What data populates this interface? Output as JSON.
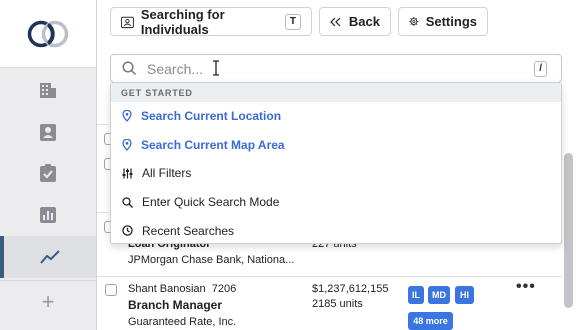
{
  "toolbar": {
    "search_mode_label": "Searching for Individuals",
    "search_mode_key": "T",
    "back_label": "Back",
    "settings_label": "Settings"
  },
  "search": {
    "placeholder": "Search...",
    "shortcut_key": "/"
  },
  "dropdown": {
    "header": "GET STARTED",
    "items": [
      {
        "label": "Search Current Location",
        "icon": "location-pin-icon"
      },
      {
        "label": "Search Current Map Area",
        "icon": "location-pin-icon"
      },
      {
        "label": "All Filters",
        "icon": "filters-icon"
      },
      {
        "label": "Enter Quick Search Mode",
        "icon": "search-icon"
      },
      {
        "label": "Recent Searches",
        "icon": "clock-icon"
      }
    ]
  },
  "rows": [
    {
      "title_partial": "Loan Originator",
      "company": "JPMorgan Chase Bank, Nationa...",
      "units": "227 units"
    },
    {
      "name": "Shant Banosian",
      "id": "7206",
      "title": "Branch Manager",
      "company": "Guaranteed Rate, Inc.",
      "volume": "$1,237,612,155",
      "units": "2185 units",
      "states": [
        "IL",
        "MD",
        "HI"
      ],
      "more": "48 more"
    }
  ],
  "colors": {
    "accent": "#3a6bd6",
    "badge": "#3a75e0",
    "sidebar_active": "#3d5a80"
  }
}
